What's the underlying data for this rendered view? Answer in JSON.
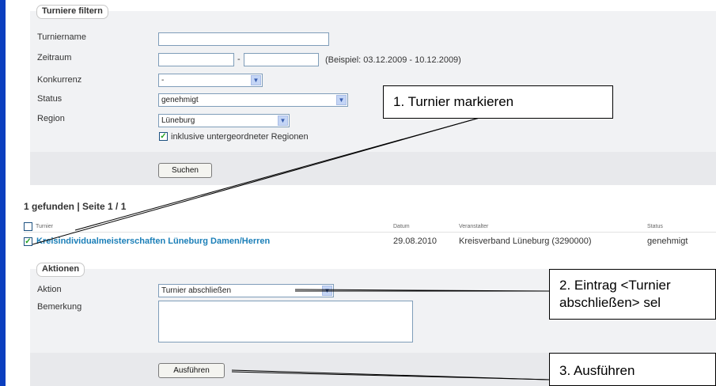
{
  "filter": {
    "legend": "Turniere filtern",
    "labels": {
      "name": "Turniername",
      "period": "Zeitraum",
      "competition": "Konkurrenz",
      "status": "Status",
      "region": "Region"
    },
    "name_value": "",
    "period_from": "",
    "period_to": "",
    "period_sep": "-",
    "period_hint": "(Beispiel: 03.12.2009 - 10.12.2009)",
    "competition_value": "-",
    "status_value": "genehmigt",
    "region_value": "Lüneburg",
    "include_sub_label": "inklusive untergeordneter Regionen",
    "include_sub_checked": true,
    "search_button": "Suchen"
  },
  "results": {
    "summary": "1 gefunden | Seite 1 / 1",
    "columns": {
      "name": "Turnier",
      "date": "Datum",
      "organizer": "Veranstalter",
      "status": "Status"
    },
    "rows": [
      {
        "selected": true,
        "name": "Kreisindividualmeisterschaften Lüneburg Damen/Herren",
        "date": "29.08.2010",
        "organizer": "Kreisverband Lüneburg (3290000)",
        "status": "genehmigt"
      }
    ]
  },
  "actions": {
    "legend": "Aktionen",
    "labels": {
      "action": "Aktion",
      "remark": "Bemerkung"
    },
    "action_value": "Turnier abschließen",
    "remark_value": "",
    "execute_button": "Ausführen"
  },
  "callouts": {
    "c1": "1. Turnier markieren",
    "c2_line1": "2. Eintrag <Turnier",
    "c2_line2": "abschließen> sel",
    "c3": "3. Ausführen"
  },
  "colors": {
    "link": "#1b7fb8",
    "accent_bar": "#0b3fbf",
    "check": "#21a121"
  }
}
